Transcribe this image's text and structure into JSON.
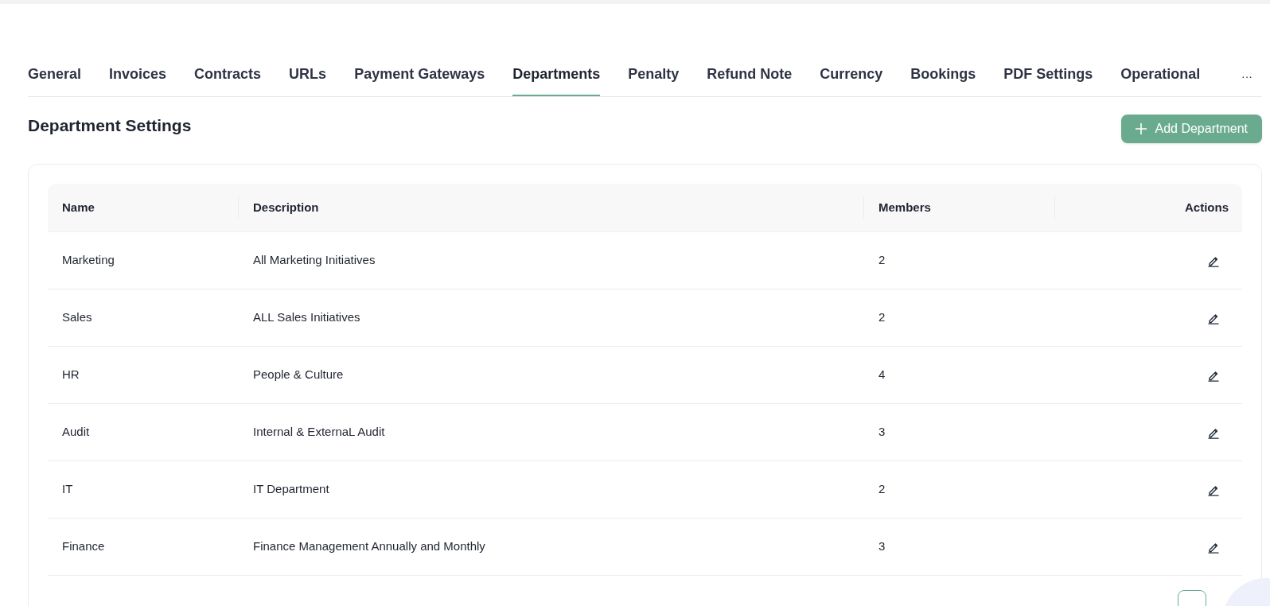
{
  "tabs": [
    {
      "label": "General",
      "selected": false
    },
    {
      "label": "Invoices",
      "selected": false
    },
    {
      "label": "Contracts",
      "selected": false
    },
    {
      "label": "URLs",
      "selected": false
    },
    {
      "label": "Payment Gateways",
      "selected": false
    },
    {
      "label": "Departments",
      "selected": true
    },
    {
      "label": "Penalty",
      "selected": false
    },
    {
      "label": "Refund Note",
      "selected": false
    },
    {
      "label": "Currency",
      "selected": false
    },
    {
      "label": "Bookings",
      "selected": false
    },
    {
      "label": "PDF Settings",
      "selected": false
    },
    {
      "label": "Operational",
      "selected": false
    }
  ],
  "more_tabs": "···",
  "title": "Department Settings",
  "add_button": "Add Department",
  "table": {
    "columns": [
      "Name",
      "Description",
      "Members",
      "Actions"
    ],
    "rows": [
      {
        "name": "Marketing",
        "description": "All Marketing Initiatives",
        "members": "2"
      },
      {
        "name": "Sales",
        "description": "ALL Sales Initiatives",
        "members": "2"
      },
      {
        "name": "HR",
        "description": "People & Culture",
        "members": "4"
      },
      {
        "name": "Audit",
        "description": "Internal & ExternaL Audit",
        "members": "3"
      },
      {
        "name": "IT",
        "description": "IT Department",
        "members": "2"
      },
      {
        "name": "Finance",
        "description": "Finance Management Annually and Monthly",
        "members": "3"
      }
    ]
  }
}
